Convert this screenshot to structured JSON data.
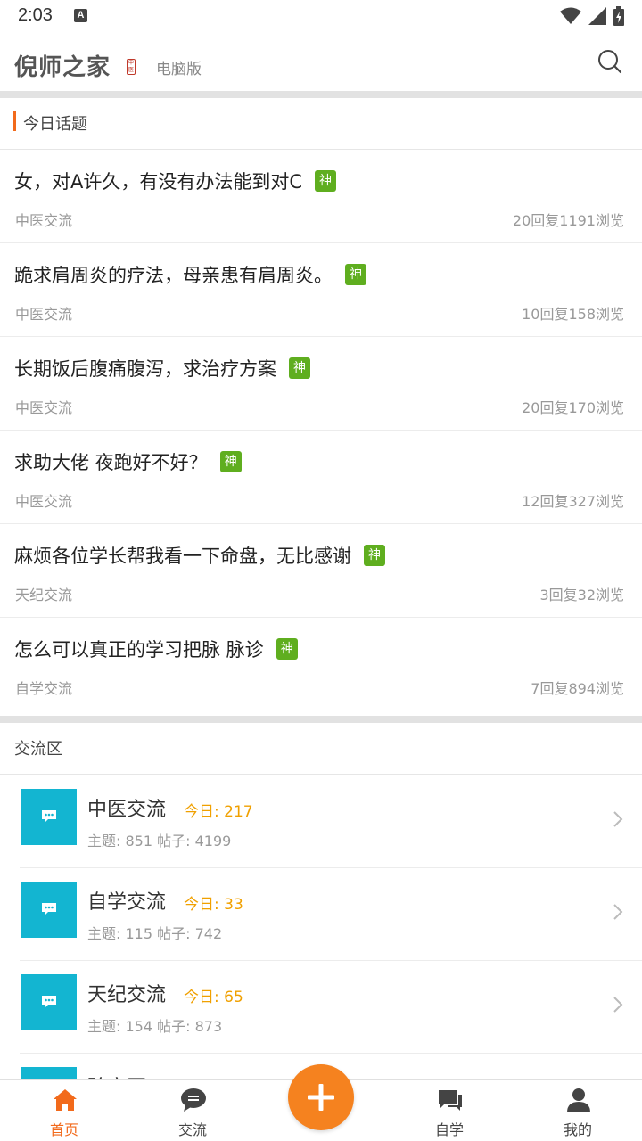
{
  "status": {
    "time": "2:03",
    "notif_letter": "A"
  },
  "header": {
    "logo_text": "倪师之家",
    "seal_text": "中医",
    "desktop_link": "电脑版"
  },
  "today": {
    "title": "今日话题",
    "badge": "神",
    "topics": [
      {
        "title": "女，对A许久，有没有办法能到对C",
        "category": "中医交流",
        "stats": "20回复1191浏览"
      },
      {
        "title": "跪求肩周炎的疗法，母亲患有肩周炎。",
        "category": "中医交流",
        "stats": "10回复158浏览"
      },
      {
        "title": "长期饭后腹痛腹泻，求治疗方案",
        "category": "中医交流",
        "stats": "20回复170浏览"
      },
      {
        "title": "求助大佬 夜跑好不好？",
        "category": "中医交流",
        "stats": "12回复327浏览"
      },
      {
        "title": "麻烦各位学长帮我看一下命盘，无比感谢",
        "category": "天纪交流",
        "stats": "3回复32浏览"
      },
      {
        "title": "怎么可以真正的学习把脉 脉诊",
        "category": "自学交流",
        "stats": "7回复894浏览"
      }
    ]
  },
  "forums": {
    "title": "交流区",
    "items": [
      {
        "name": "中医交流",
        "today": "今日: 217",
        "meta": "主题: 851  帖子: 4199"
      },
      {
        "name": "自学交流",
        "today": "今日: 33",
        "meta": "主题: 115  帖子: 742"
      },
      {
        "name": "天纪交流",
        "today": "今日: 65",
        "meta": "主题: 154  帖子: 873"
      },
      {
        "name": "验方区",
        "today": "",
        "meta": ""
      }
    ]
  },
  "nav": {
    "home": "首页",
    "exchange": "交流",
    "self_study": "自学",
    "mine": "我的"
  },
  "colors": {
    "accent": "#f26a1b",
    "badge_green": "#5fae1f",
    "forum_icon": "#13b5d1",
    "today_count": "#f0a000"
  }
}
